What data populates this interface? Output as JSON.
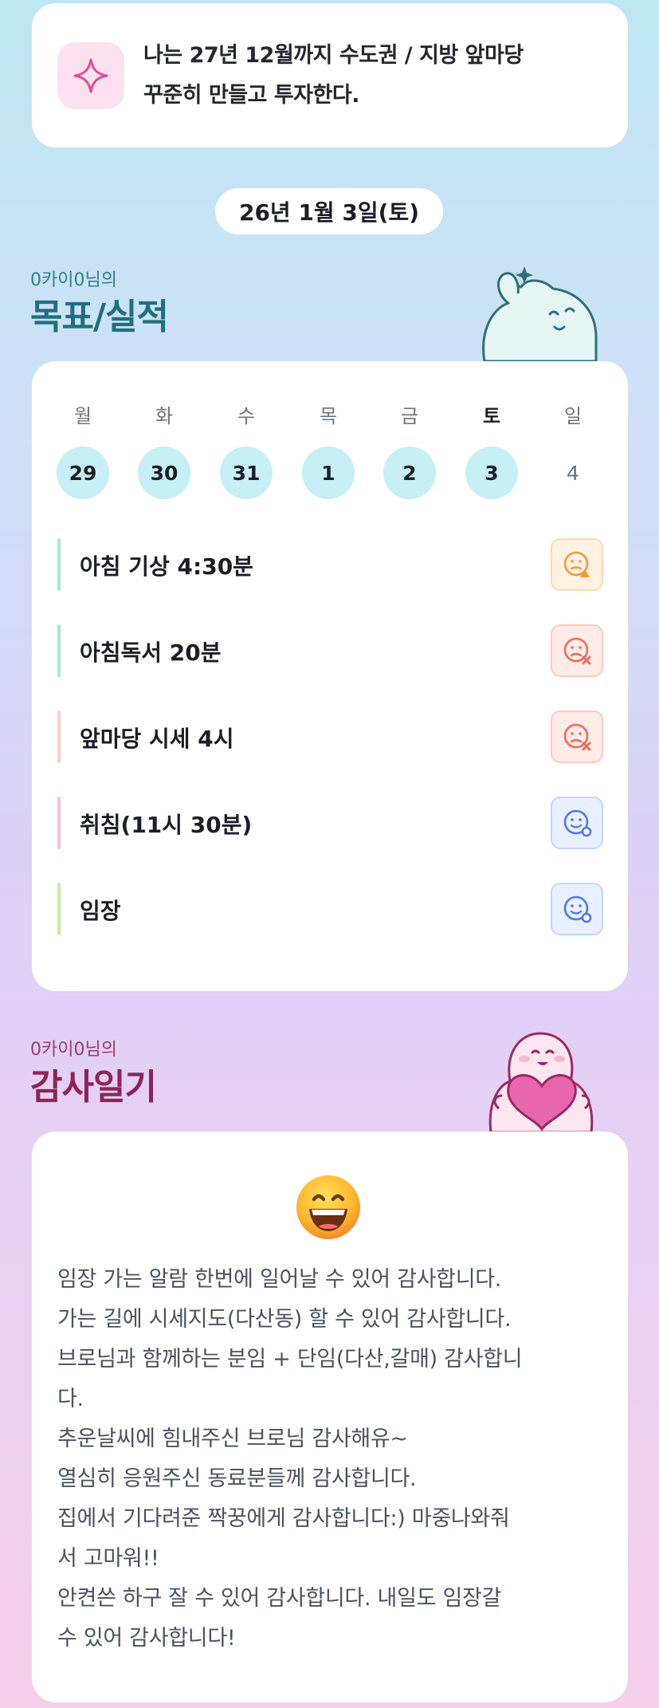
{
  "goal": {
    "icon": "sparkle-icon",
    "line1": "나는 27년 12월까지 수도권 / 지방 앞마당",
    "line2": "꾸준히 만들고 투자한다."
  },
  "date": "26년 1월 3일(토)",
  "tracker": {
    "owner": "0카이0님의",
    "title": "목표/실적",
    "weekdays": [
      "월",
      "화",
      "수",
      "목",
      "금",
      "토",
      "일"
    ],
    "dates": [
      "29",
      "30",
      "31",
      "1",
      "2",
      "3",
      "4"
    ],
    "habits": [
      {
        "label": "아침 기상 4:30분",
        "status": "warning-face-icon",
        "bar_color": "#a8e6d3"
      },
      {
        "label": "아침독서 20분",
        "status": "fail-face-icon",
        "bar_color": "#a8e6d3"
      },
      {
        "label": "앞마당 시세 4시",
        "status": "fail-face-icon",
        "bar_color": "#f9cfc7"
      },
      {
        "label": "취침(11시 30분)",
        "status": "success-face-icon",
        "bar_color": "#f7c2df"
      },
      {
        "label": "임장",
        "status": "success-face-icon",
        "bar_color": "#c8ec9f"
      }
    ]
  },
  "diary": {
    "owner": "0카이0님의",
    "title": "감사일기",
    "emoji": "grinning-face-icon",
    "text": "임장 가는 알람 한번에 일어날 수 있어 감사합니다.\n가는 길에 시세지도(다산동) 할 수 있어 감사합니다.\n브로님과 함께하는 분임 + 단임(다산,갈매) 감사합니\n다.\n추운날씨에 힘내주신 브로님 감사해유~\n열심히 응원주신 동료분들께 감사합니다.\n집에서 기다려준 짝꿍에게 감사합니다:) 마중나와줘\n서 고마워!!\n안켠쓴 하구 잘 수 있어 감사합니다. 내일도 임장갈\n수 있어 감사합니다!"
  },
  "colors": {
    "accent_teal": "#1f6f7f",
    "accent_plum": "#8e2459",
    "date_circle": "#c6eff6",
    "warn": "#f39a3b",
    "fail": "#ee6b5b",
    "ok": "#4f78e8"
  }
}
